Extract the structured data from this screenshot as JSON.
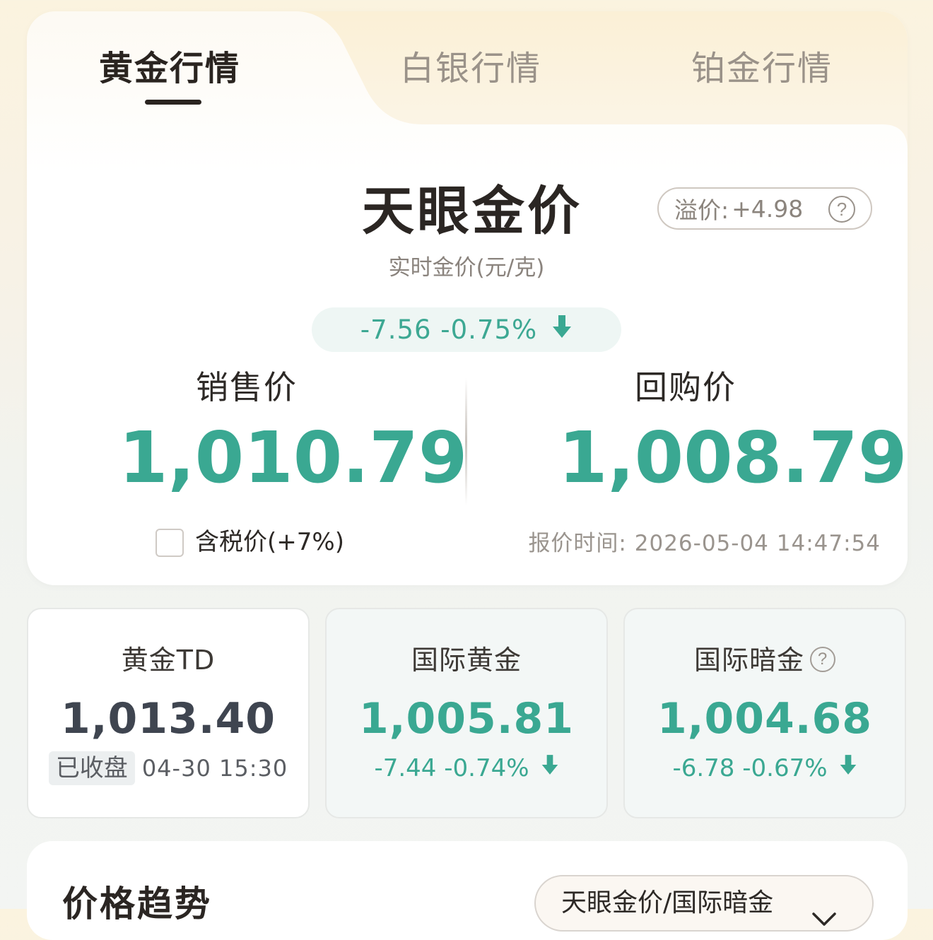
{
  "tabs": [
    {
      "label": "黄金行情",
      "active": true
    },
    {
      "label": "白银行情",
      "active": false
    },
    {
      "label": "铂金行情",
      "active": false
    }
  ],
  "main": {
    "title": "天眼金价",
    "premium_label": "溢价:",
    "premium_value": "+4.98",
    "subtitle": "实时金价(元/克)",
    "change": "-7.56 -0.75%",
    "sell_label": "销售价",
    "sell_price": "1,010.79",
    "buy_label": "回购价",
    "buy_price": "1,008.79",
    "tax_label": "含税价(+7%)",
    "tax_checked": false,
    "quote_time_label": "报价时间:",
    "quote_time": "2026-05-04 14:47:54"
  },
  "cards": [
    {
      "title": "黄金TD",
      "value": "1,013.40",
      "badge": "已收盘",
      "time": "04-30 15:30"
    },
    {
      "title": "国际黄金",
      "value": "1,005.81",
      "change": "-7.44 -0.74%"
    },
    {
      "title": "国际暗金",
      "value": "1,004.68",
      "change": "-6.78 -0.67%"
    }
  ],
  "trend": {
    "title": "价格趋势",
    "selector": "天眼金价/国际暗金"
  },
  "colors": {
    "accent_green": "#3aa892",
    "title_dark": "#2b2623",
    "tab_inactive": "#9a9289"
  },
  "icons": [
    "help-icon",
    "arrow-down-icon",
    "chevron-down-icon"
  ]
}
